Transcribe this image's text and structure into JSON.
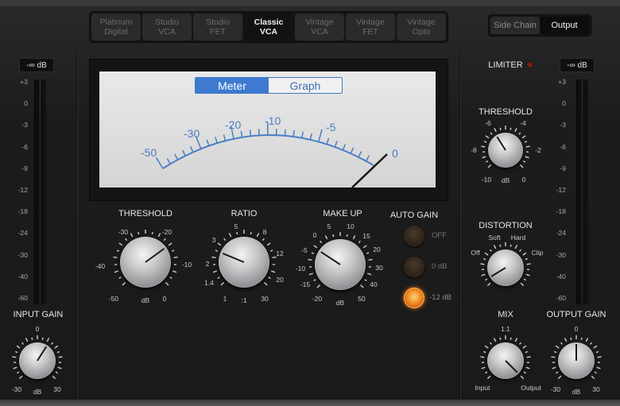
{
  "models": [
    {
      "label": "Platinum\nDigital",
      "active": false
    },
    {
      "label": "Studio\nVCA",
      "active": false
    },
    {
      "label": "Studio\nFET",
      "active": false
    },
    {
      "label": "Classic\nVCA",
      "active": true
    },
    {
      "label": "Vintage\nVCA",
      "active": false
    },
    {
      "label": "Vintage\nFET",
      "active": false
    },
    {
      "label": "Vintage\nOpto",
      "active": false
    }
  ],
  "routing": {
    "side_chain": "Side Chain",
    "output": "Output",
    "selected": "output"
  },
  "input_meter": {
    "readout": "-∞ dB",
    "scale": [
      "+3",
      "0",
      "-3",
      "-6",
      "-9",
      "-12",
      "-18",
      "-24",
      "-30",
      "-40",
      "-60"
    ]
  },
  "output_meter": {
    "readout": "-∞ dB",
    "scale": [
      "+3",
      "0",
      "-3",
      "-6",
      "-9",
      "-12",
      "-18",
      "-24",
      "-30",
      "-40",
      "-60"
    ]
  },
  "vu": {
    "toggle": {
      "meter": "Meter",
      "graph": "Graph",
      "selected": "meter"
    },
    "scale": [
      "-50",
      "-30",
      "-20",
      "-10",
      "-5",
      "0"
    ]
  },
  "threshold": {
    "label": "THRESHOLD",
    "ticks": [
      "-50",
      "-40",
      "-30",
      "-20",
      "-10",
      "0"
    ],
    "unit": "dB",
    "value_fraction": 0.7
  },
  "ratio": {
    "label": "RATIO",
    "ticks": [
      "1",
      "1.4",
      "2",
      "3",
      "5",
      "8",
      "12",
      "20",
      "30"
    ],
    "unit": ":1",
    "value_fraction": 0.25
  },
  "makeup": {
    "label": "MAKE UP",
    "ticks": [
      "-20",
      "-15",
      "-10",
      "-5",
      "0",
      "5",
      "10",
      "15",
      "20",
      "30",
      "40",
      "50"
    ],
    "unit": "dB",
    "value_fraction": 0.29
  },
  "auto_gain": {
    "label": "AUTO GAIN",
    "options": [
      "OFF",
      "0 dB",
      "-12 dB"
    ],
    "selected": 2
  },
  "limiter": {
    "label": "LIMITER"
  },
  "limiter_threshold": {
    "label": "THRESHOLD",
    "ticks": [
      "-10",
      "-8",
      "-6",
      "-4",
      "-2",
      "0"
    ],
    "unit": "dB",
    "value_fraction": 0.38
  },
  "distortion": {
    "label": "DISTORTION",
    "ticks": [
      "Off",
      "Soft",
      "Hard",
      "Clip"
    ],
    "value_fraction": 0.05
  },
  "mix": {
    "label": "MIX",
    "ticks": [
      "Input",
      "1:1",
      "Output"
    ],
    "value_fraction": 1.0
  },
  "input_gain": {
    "label": "INPUT GAIN",
    "ticks": [
      "-30",
      "0",
      "30"
    ],
    "unit": "dB",
    "value_fraction": 0.62
  },
  "output_gain": {
    "label": "OUTPUT GAIN",
    "ticks": [
      "-30",
      "0",
      "30"
    ],
    "unit": "dB",
    "value_fraction": 0.5
  },
  "colors": {
    "accent": "#3d7ad0",
    "vu_ink": "#4a7fc4",
    "led_on": "#f08a1e"
  }
}
